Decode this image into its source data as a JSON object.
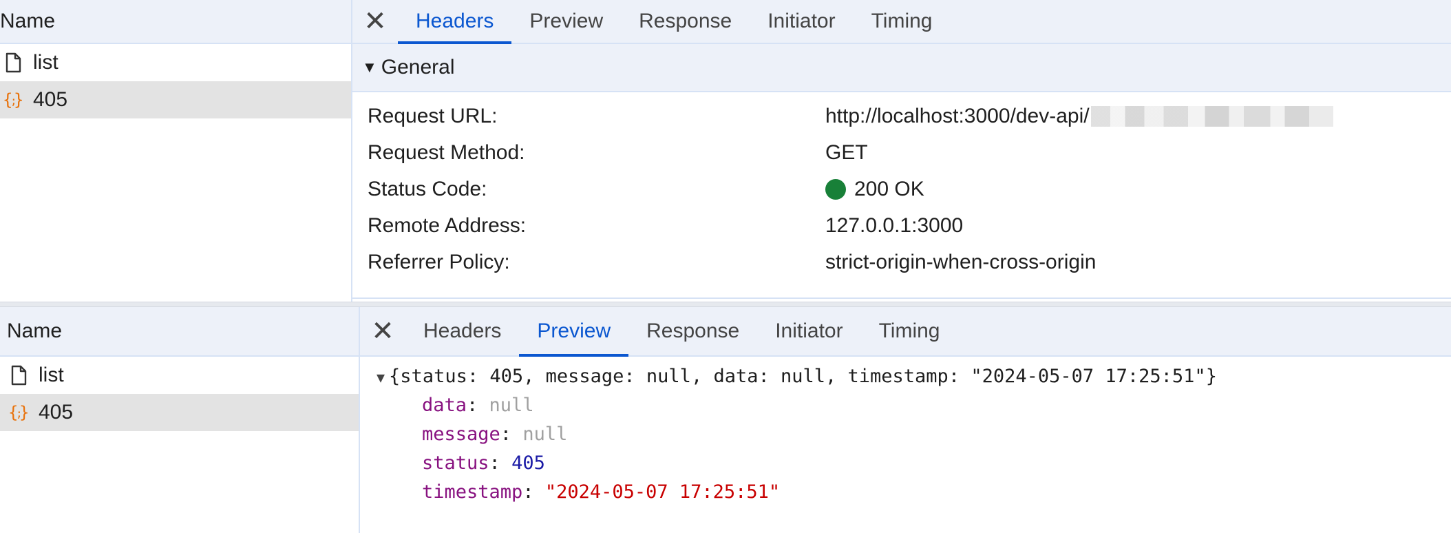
{
  "top_panel": {
    "name_header": "Name",
    "requests": [
      {
        "label": "list",
        "icon": "document-icon"
      },
      {
        "label": "405",
        "icon": "json-braces-icon"
      }
    ],
    "close_glyph": "✕",
    "tabs": [
      "Headers",
      "Preview",
      "Response",
      "Initiator",
      "Timing"
    ],
    "active_tab": "Headers",
    "general": {
      "title": "General",
      "rows": [
        {
          "key": "Request URL:",
          "value": "http://localhost:3000/dev-api/"
        },
        {
          "key": "Request Method:",
          "value": "GET"
        },
        {
          "key": "Status Code:",
          "value": "200 OK"
        },
        {
          "key": "Remote Address:",
          "value": "127.0.0.1:3000"
        },
        {
          "key": "Referrer Policy:",
          "value": "strict-origin-when-cross-origin"
        }
      ]
    }
  },
  "bottom_panel": {
    "name_header": "Name",
    "requests": [
      {
        "label": "list",
        "icon": "document-icon"
      },
      {
        "label": "405",
        "icon": "json-braces-icon"
      }
    ],
    "close_glyph": "✕",
    "tabs": [
      "Headers",
      "Preview",
      "Response",
      "Initiator",
      "Timing"
    ],
    "active_tab": "Preview",
    "preview": {
      "summary": "{status: 405, message: null, data: null, timestamp: \"2024-05-07 17:25:51\"}",
      "props": [
        {
          "key": "data",
          "sep": ": ",
          "value": "null",
          "type": "null"
        },
        {
          "key": "message",
          "sep": ": ",
          "value": "null",
          "type": "null"
        },
        {
          "key": "status",
          "sep": ": ",
          "value": "405",
          "type": "num"
        },
        {
          "key": "timestamp",
          "sep": ": ",
          "value": "\"2024-05-07 17:25:51\"",
          "type": "str"
        }
      ]
    }
  },
  "colors": {
    "accent": "#0b57d0",
    "status_ok": "#188038",
    "json_key": "#881280",
    "json_string": "#c80000",
    "json_number": "#1a1aa6",
    "json_null": "#a0a0a0",
    "icon_orange": "#e8710a"
  }
}
